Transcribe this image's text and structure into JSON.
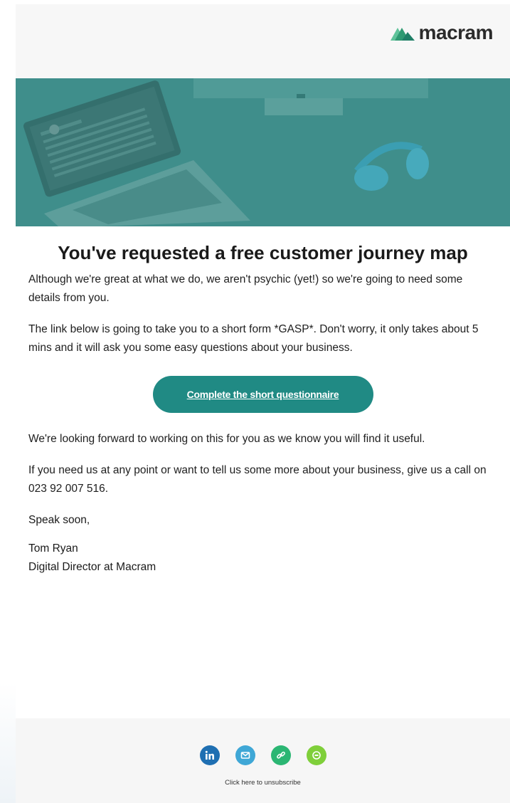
{
  "brand": {
    "name": "macram",
    "accent": "#208a84",
    "logo_green": "#2e9a72"
  },
  "email": {
    "headline": "You've requested a free customer journey map",
    "paragraphs": [
      "Although we're great at what we do, we aren't psychic (yet!) so we're going to need some details from you.",
      "The link below is going to take you to a short form *GASP*. Don't worry, it only takes about 5 mins and it will ask you some easy questions about your business."
    ],
    "cta_label": "Complete the short questionnaire",
    "closing_paragraphs": [
      "We're looking forward to working on this for you as we know you will find it useful.",
      "If you need us at any point or want to tell us some more about your business, give us a call on 023 92 007 516."
    ],
    "sign_off": "Speak soon,",
    "signature": {
      "name": "Tom Ryan",
      "title": "Digital Director at Macram"
    }
  },
  "footer": {
    "social": [
      {
        "icon": "linkedin-icon",
        "color": "#1f6fb2",
        "glyph": "in"
      },
      {
        "icon": "email-icon",
        "color": "#3fa7d6",
        "glyph": "✉"
      },
      {
        "icon": "link-icon",
        "color": "#2bb673",
        "glyph": "🔗"
      },
      {
        "icon": "chat-icon",
        "color": "#7fcf3a",
        "glyph": "💬"
      }
    ],
    "unsubscribe": "Click here to unsubscribe"
  }
}
